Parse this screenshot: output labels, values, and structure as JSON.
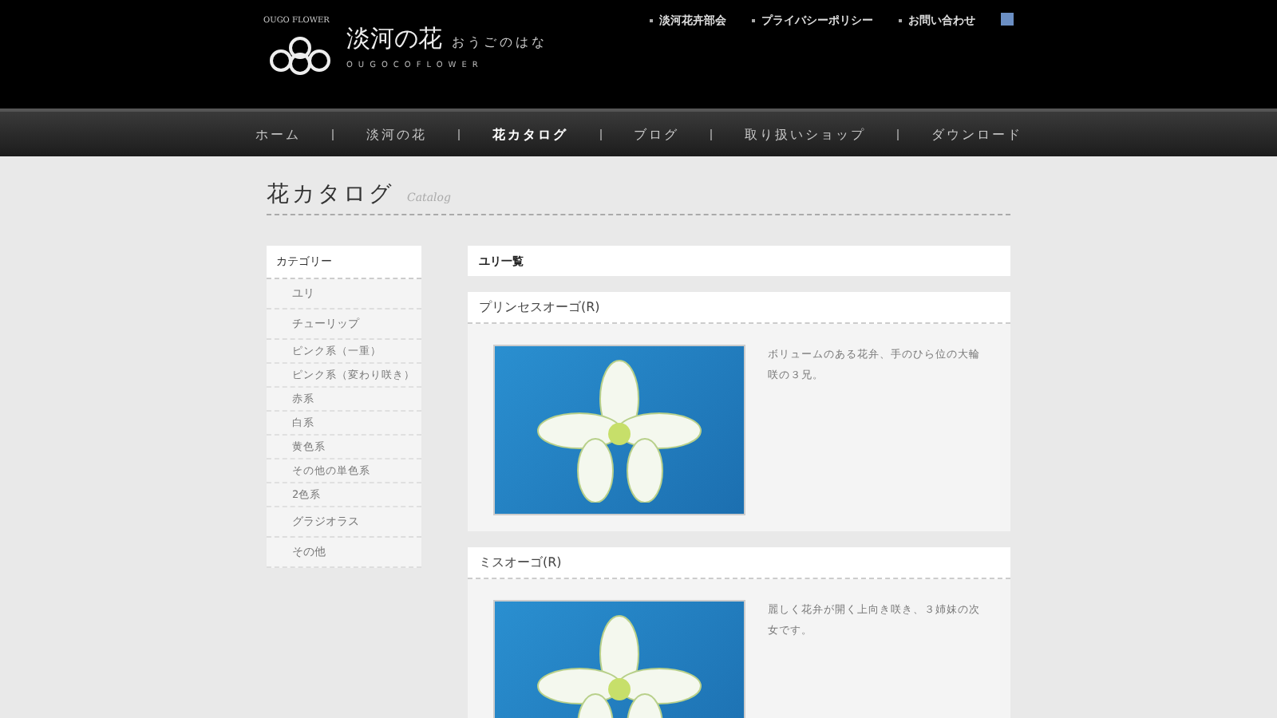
{
  "logo": {
    "name": "淡河の花",
    "reading": "おうごのはな",
    "roman": "OUGOCOFLOWER",
    "badge": "OUGO FLOWER"
  },
  "header_links": [
    "淡河花卉部会",
    "プライバシーポリシー",
    "お問い合わせ"
  ],
  "nav": [
    {
      "label": "ホーム",
      "selected": false
    },
    {
      "label": "淡河の花",
      "selected": false
    },
    {
      "label": "花カタログ",
      "selected": true
    },
    {
      "label": "ブログ",
      "selected": false
    },
    {
      "label": "取り扱いショップ",
      "selected": false
    },
    {
      "label": "ダウンロード",
      "selected": false
    }
  ],
  "page_title": {
    "title": "花カタログ",
    "subtitle": "Catalog"
  },
  "sidebar": {
    "heading": "カテゴリー",
    "items": [
      {
        "label": "ユリ"
      },
      {
        "label": "チューリップ",
        "children": [
          {
            "label": "ピンク系（一重）"
          },
          {
            "label": "ピンク系（変わり咲き）"
          },
          {
            "label": "赤系"
          },
          {
            "label": "白系"
          },
          {
            "label": "黄色系"
          },
          {
            "label": "その他の単色系"
          },
          {
            "label": "2色系"
          }
        ]
      },
      {
        "label": "グラジオラス"
      },
      {
        "label": "その他"
      }
    ]
  },
  "section_title": "ユリ一覧",
  "products": [
    {
      "name": "プリンセスオーゴ(R)",
      "description": "ボリュームのある花弁、手のひら位の大輪咲の３兄。"
    },
    {
      "name": "ミスオーゴ(R)",
      "description": "麗しく花弁が開く上向き咲き、３姉妹の次女です。"
    }
  ]
}
